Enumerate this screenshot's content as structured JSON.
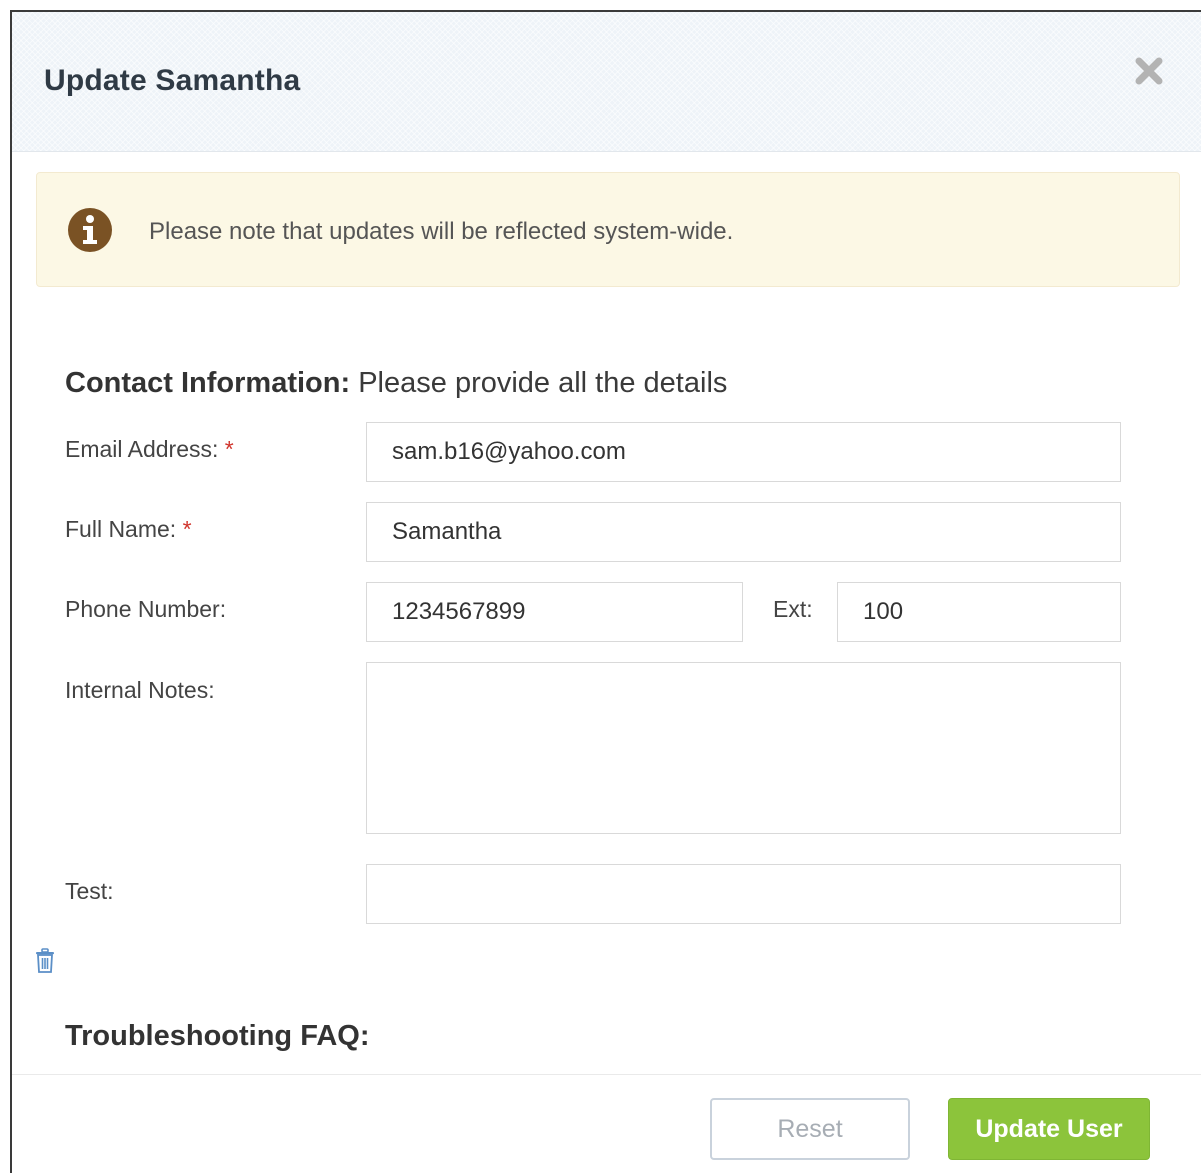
{
  "dialog": {
    "title": "Update Samantha"
  },
  "alert": {
    "message": "Please note that updates will be reflected system-wide."
  },
  "contact_section": {
    "heading_bold": "Contact Information:",
    "heading_rest": " Please provide all the details"
  },
  "form": {
    "email": {
      "label": "Email Address:",
      "required_mark": "*",
      "value": "sam.b16@yahoo.com"
    },
    "full_name": {
      "label": "Full Name:",
      "required_mark": "*",
      "value": "Samantha"
    },
    "phone": {
      "label": "Phone Number:",
      "value": "1234567899"
    },
    "ext": {
      "label": "Ext:",
      "value": "100"
    },
    "notes": {
      "label": "Internal Notes:",
      "value": ""
    },
    "test": {
      "label": "Test:",
      "value": ""
    }
  },
  "faq_section": {
    "heading": "Troubleshooting FAQ:"
  },
  "footer": {
    "reset_label": "Reset",
    "update_label": "Update User"
  },
  "icons": {
    "close": "close-icon",
    "alert": "info-icon",
    "trash": "trash-icon"
  },
  "colors": {
    "accent_green": "#8cc43b",
    "alert_bg": "#fcf8e5",
    "alert_icon": "#7a5224",
    "required": "#d0342c",
    "trash_icon": "#5b8fc7"
  }
}
